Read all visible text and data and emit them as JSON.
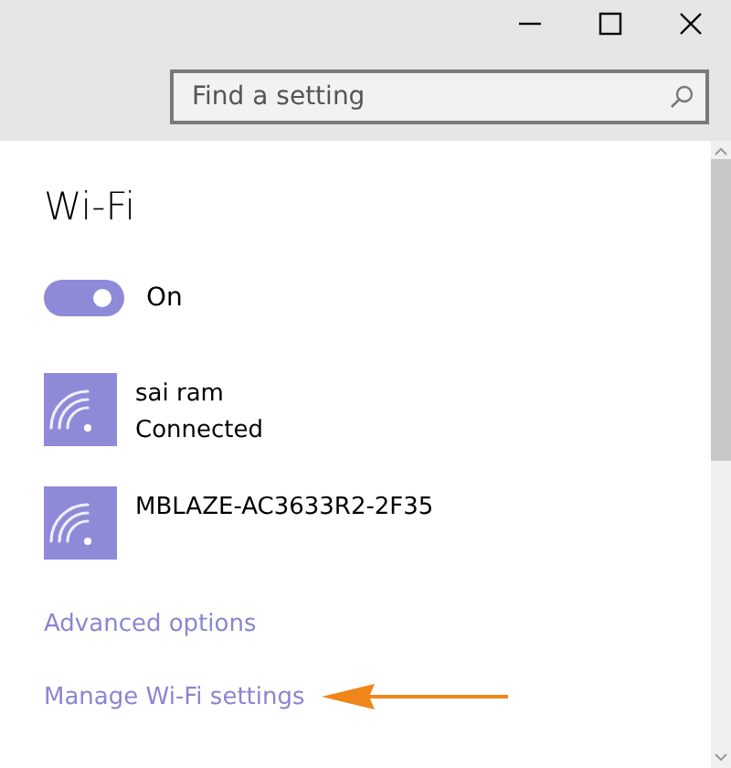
{
  "search": {
    "placeholder": "Find a setting"
  },
  "title": "Wi-Fi",
  "toggle": {
    "on": true,
    "label": "On"
  },
  "networks": [
    {
      "name": "sai ram",
      "status": "Connected"
    },
    {
      "name": "MBLAZE-AC3633R2-2F35"
    }
  ],
  "links": [
    "Advanced options",
    "Manage Wi-Fi settings"
  ]
}
